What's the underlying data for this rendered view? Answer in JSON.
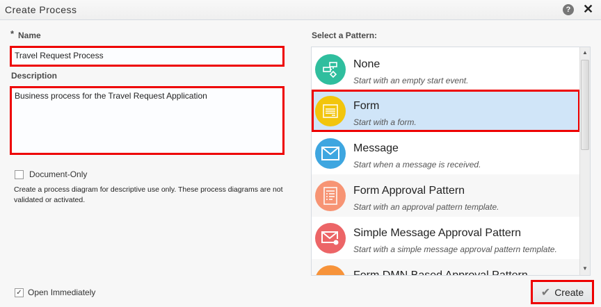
{
  "dialog": {
    "title": "Create Process"
  },
  "form": {
    "name_label": "Name",
    "required_mark": "*",
    "name_value": "Travel Request Process",
    "description_label": "Description",
    "description_value": "Business process for the Travel Request Application",
    "document_only_label": "Document-Only",
    "document_only_checked": false,
    "document_only_help": "Create a process diagram for descriptive use only. These process diagrams are not validated or activated.",
    "open_immediately_label": "Open Immediately",
    "open_immediately_checked": true
  },
  "patterns": {
    "label": "Select a Pattern:",
    "items": [
      {
        "title": "None",
        "subtitle": "Start with an empty start event.",
        "color": "#2fbe9e",
        "icon": "process-diagram-icon"
      },
      {
        "title": "Form",
        "subtitle": "Start with a form.",
        "color": "#f2c50c",
        "icon": "form-icon",
        "selected": true
      },
      {
        "title": "Message",
        "subtitle": "Start when a message is received.",
        "color": "#3ea6e0",
        "icon": "envelope-icon"
      },
      {
        "title": "Form Approval Pattern",
        "subtitle": "Start with an approval pattern template.",
        "color": "#f79474",
        "icon": "checklist-icon"
      },
      {
        "title": "Simple Message Approval Pattern",
        "subtitle": "Start with a simple message approval pattern template.",
        "color": "#ec6567",
        "icon": "envelope-check-icon"
      },
      {
        "title": "Form DMN Based Approval Pattern",
        "subtitle": "",
        "color": "#f7933a",
        "icon": "dmn-icon"
      }
    ]
  },
  "buttons": {
    "create": "Create"
  }
}
